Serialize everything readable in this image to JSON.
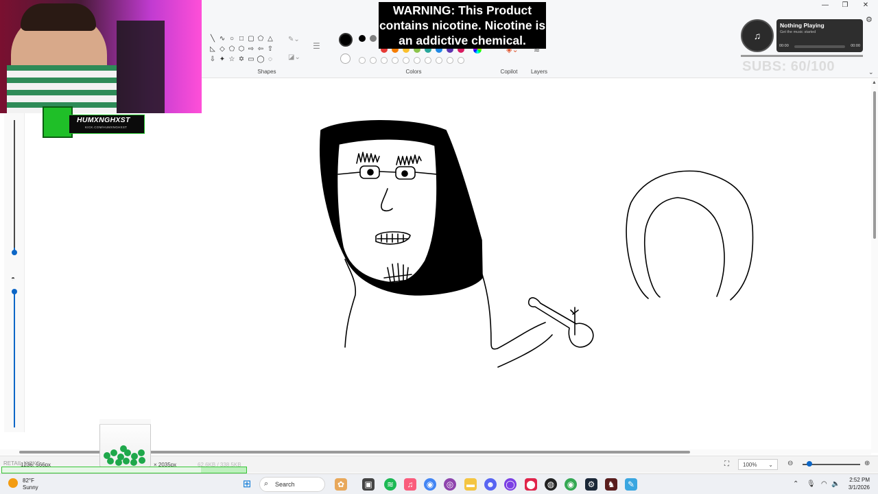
{
  "ribbon": {
    "groups": {
      "shapes": "Shapes",
      "colors": "Colors",
      "copilot": "Copilot",
      "layers": "Layers"
    }
  },
  "warning": {
    "text": "WARNING: This Product contains nicotine. Nicotine is an addictive chemical."
  },
  "streamer_badge": {
    "name": "HUMXNGHXST",
    "sub": "KICK.COM/HUMXNGHXST"
  },
  "music_widget": {
    "title": "Nothing Playing",
    "status": "Get the music started",
    "time_start": "00:00",
    "time_end": "00:00"
  },
  "subs_goal": {
    "text": "SUBS: 60/100"
  },
  "status_bar": {
    "cursor_position": "1236, 566px",
    "canvas_size": "× 2035px",
    "selection_size": "62.6KB / 338.5KB",
    "zoom": "100%"
  },
  "goal_overlay": {
    "label": "RETAIL KICKS"
  },
  "taskbar": {
    "weather_temp": "82°F",
    "weather_desc": "Sunny",
    "search_placeholder": "Search",
    "time": "2:52 PM",
    "date": "3/1/2026"
  },
  "colors": {
    "accent": "#0d67c7",
    "palette_row1": [
      "#000000",
      "#7f7f7f",
      "#e53935",
      "#f57c00",
      "#fbc02d",
      "#8bc34a",
      "#26a69a",
      "#1e88e5",
      "#5e35b1",
      "#d81b60"
    ],
    "green_brand": "#1fbf28"
  }
}
